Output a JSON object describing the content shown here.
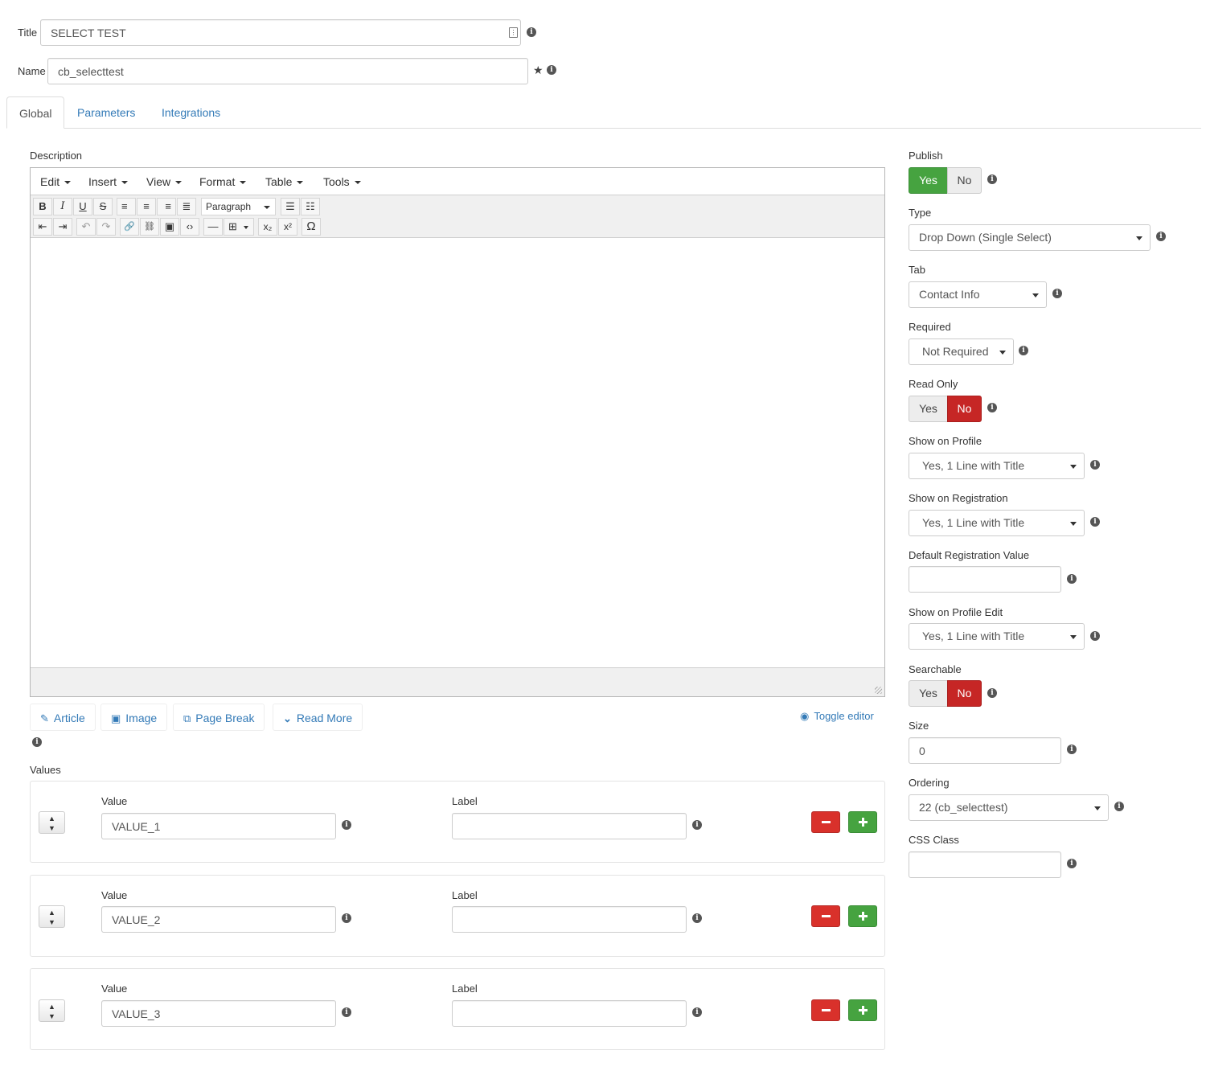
{
  "header": {
    "title_label": "Title",
    "title_value": "SELECT TEST",
    "name_label": "Name",
    "name_value": "cb_selecttest"
  },
  "tabs": [
    {
      "label": "Global",
      "active": true
    },
    {
      "label": "Parameters",
      "active": false
    },
    {
      "label": "Integrations",
      "active": false
    }
  ],
  "description": {
    "label": "Description",
    "menu": [
      "Edit",
      "Insert",
      "View",
      "Format",
      "Table",
      "Tools"
    ],
    "format_select": "Paragraph",
    "toolbar_row1": [
      {
        "name": "bold-icon",
        "glyph": "B"
      },
      {
        "name": "italic-icon",
        "glyph": "I"
      },
      {
        "name": "underline-icon",
        "glyph": "U"
      },
      {
        "name": "strikethrough-icon",
        "glyph": "S"
      },
      {
        "name": "align-left-icon",
        "glyph": "≡"
      },
      {
        "name": "align-center-icon",
        "glyph": "≡"
      },
      {
        "name": "align-right-icon",
        "glyph": "≡"
      },
      {
        "name": "align-justify-icon",
        "glyph": "≣"
      }
    ],
    "toolbar_lists": [
      {
        "name": "bullet-list-icon",
        "glyph": "☰"
      },
      {
        "name": "numbered-list-icon",
        "glyph": "☷"
      }
    ],
    "toolbar_row2": [
      {
        "name": "outdent-icon",
        "glyph": "⇤"
      },
      {
        "name": "indent-icon",
        "glyph": "⇥"
      },
      {
        "name": "undo-icon",
        "glyph": "↶"
      },
      {
        "name": "redo-icon",
        "glyph": "↷"
      },
      {
        "name": "link-icon",
        "glyph": "🔗"
      },
      {
        "name": "unlink-icon",
        "glyph": "⛓"
      },
      {
        "name": "image-icon",
        "glyph": "▣"
      },
      {
        "name": "code-icon",
        "glyph": "‹›"
      },
      {
        "name": "horizontal-rule-icon",
        "glyph": "—"
      },
      {
        "name": "table-icon",
        "glyph": "⊞"
      },
      {
        "name": "subscript-icon",
        "glyph": "x₂"
      },
      {
        "name": "superscript-icon",
        "glyph": "x²"
      },
      {
        "name": "special-char-icon",
        "glyph": "Ω"
      }
    ],
    "buttons": [
      {
        "name": "article-button",
        "icon": "article-icon",
        "glyph": "✎",
        "label": "Article"
      },
      {
        "name": "image-button",
        "icon": "image-icon",
        "glyph": "▣",
        "label": "Image"
      },
      {
        "name": "page-break-button",
        "icon": "copy-icon",
        "glyph": "⧉",
        "label": "Page Break"
      },
      {
        "name": "read-more-button",
        "icon": "chevron-down-icon",
        "glyph": "⌄",
        "label": "Read More"
      }
    ],
    "toggle_editor": "Toggle editor"
  },
  "values": {
    "label": "Values",
    "value_label": "Value",
    "label_label": "Label",
    "rows": [
      {
        "value": "VALUE_1",
        "label": ""
      },
      {
        "value": "VALUE_2",
        "label": ""
      },
      {
        "value": "VALUE_3",
        "label": ""
      }
    ]
  },
  "sidebar": {
    "publish": {
      "label": "Publish",
      "yes": "Yes",
      "no": "No",
      "selected": "yes"
    },
    "type": {
      "label": "Type",
      "value": "Drop Down (Single Select)"
    },
    "tab": {
      "label": "Tab",
      "value": "Contact Info"
    },
    "required": {
      "label": "Required",
      "value": "Not Required"
    },
    "read_only": {
      "label": "Read Only",
      "yes": "Yes",
      "no": "No",
      "selected": "no"
    },
    "show_on_profile": {
      "label": "Show on Profile",
      "value": "Yes, 1 Line with Title"
    },
    "show_on_registration": {
      "label": "Show on Registration",
      "value": "Yes, 1 Line with Title"
    },
    "default_registration_value": {
      "label": "Default Registration Value",
      "value": ""
    },
    "show_on_profile_edit": {
      "label": "Show on Profile Edit",
      "value": "Yes, 1 Line with Title"
    },
    "searchable": {
      "label": "Searchable",
      "yes": "Yes",
      "no": "No",
      "selected": "no"
    },
    "size": {
      "label": "Size",
      "value": "0"
    },
    "ordering": {
      "label": "Ordering",
      "value": "22 (cb_selecttest)"
    },
    "css_class": {
      "label": "CSS Class",
      "value": ""
    }
  },
  "colors": {
    "link": "#337ab7",
    "green": "#46a340",
    "red": "#c62625"
  }
}
